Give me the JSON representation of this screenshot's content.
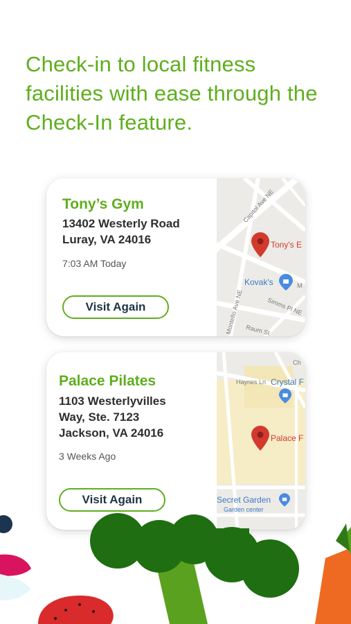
{
  "headline": {
    "line1": "Check-in to local fitness",
    "line2": "facilities with ease through the",
    "line3": "Check-In feature."
  },
  "checkins": [
    {
      "name": "Tony’s Gym",
      "address_line1": "13402 Westerly Road",
      "address_line2": "Luray, VA 24016",
      "time": "7:03 AM Today",
      "button": "Visit Again",
      "map": {
        "pin_label": "Tony's E",
        "poi_label": "Kovak's",
        "poi_label2": "M",
        "street1": "Capitol Ave NE",
        "street2": "Montello Ave NE",
        "street3": "Simms Pl NE",
        "street4": "Raum St"
      }
    },
    {
      "name": "Palace Pilates",
      "address_line1": "1103 Westerlyvilles",
      "address_line2": "Way, Ste. 7123",
      "address_line3": "Jackson, VA 24016",
      "time": "3 Weeks Ago",
      "button": "Visit Again",
      "map": {
        "pin_label": "Palace F",
        "poi_label": "Crystal F",
        "poi_label2": "Secret Garden",
        "poi_sub": "Garden center",
        "street1": "Haynes Ln",
        "street2": "Ch"
      }
    }
  ],
  "colors": {
    "brand_green": "#5fae1e",
    "button_text": "#1f3345",
    "pin_red": "#d23a2e"
  }
}
